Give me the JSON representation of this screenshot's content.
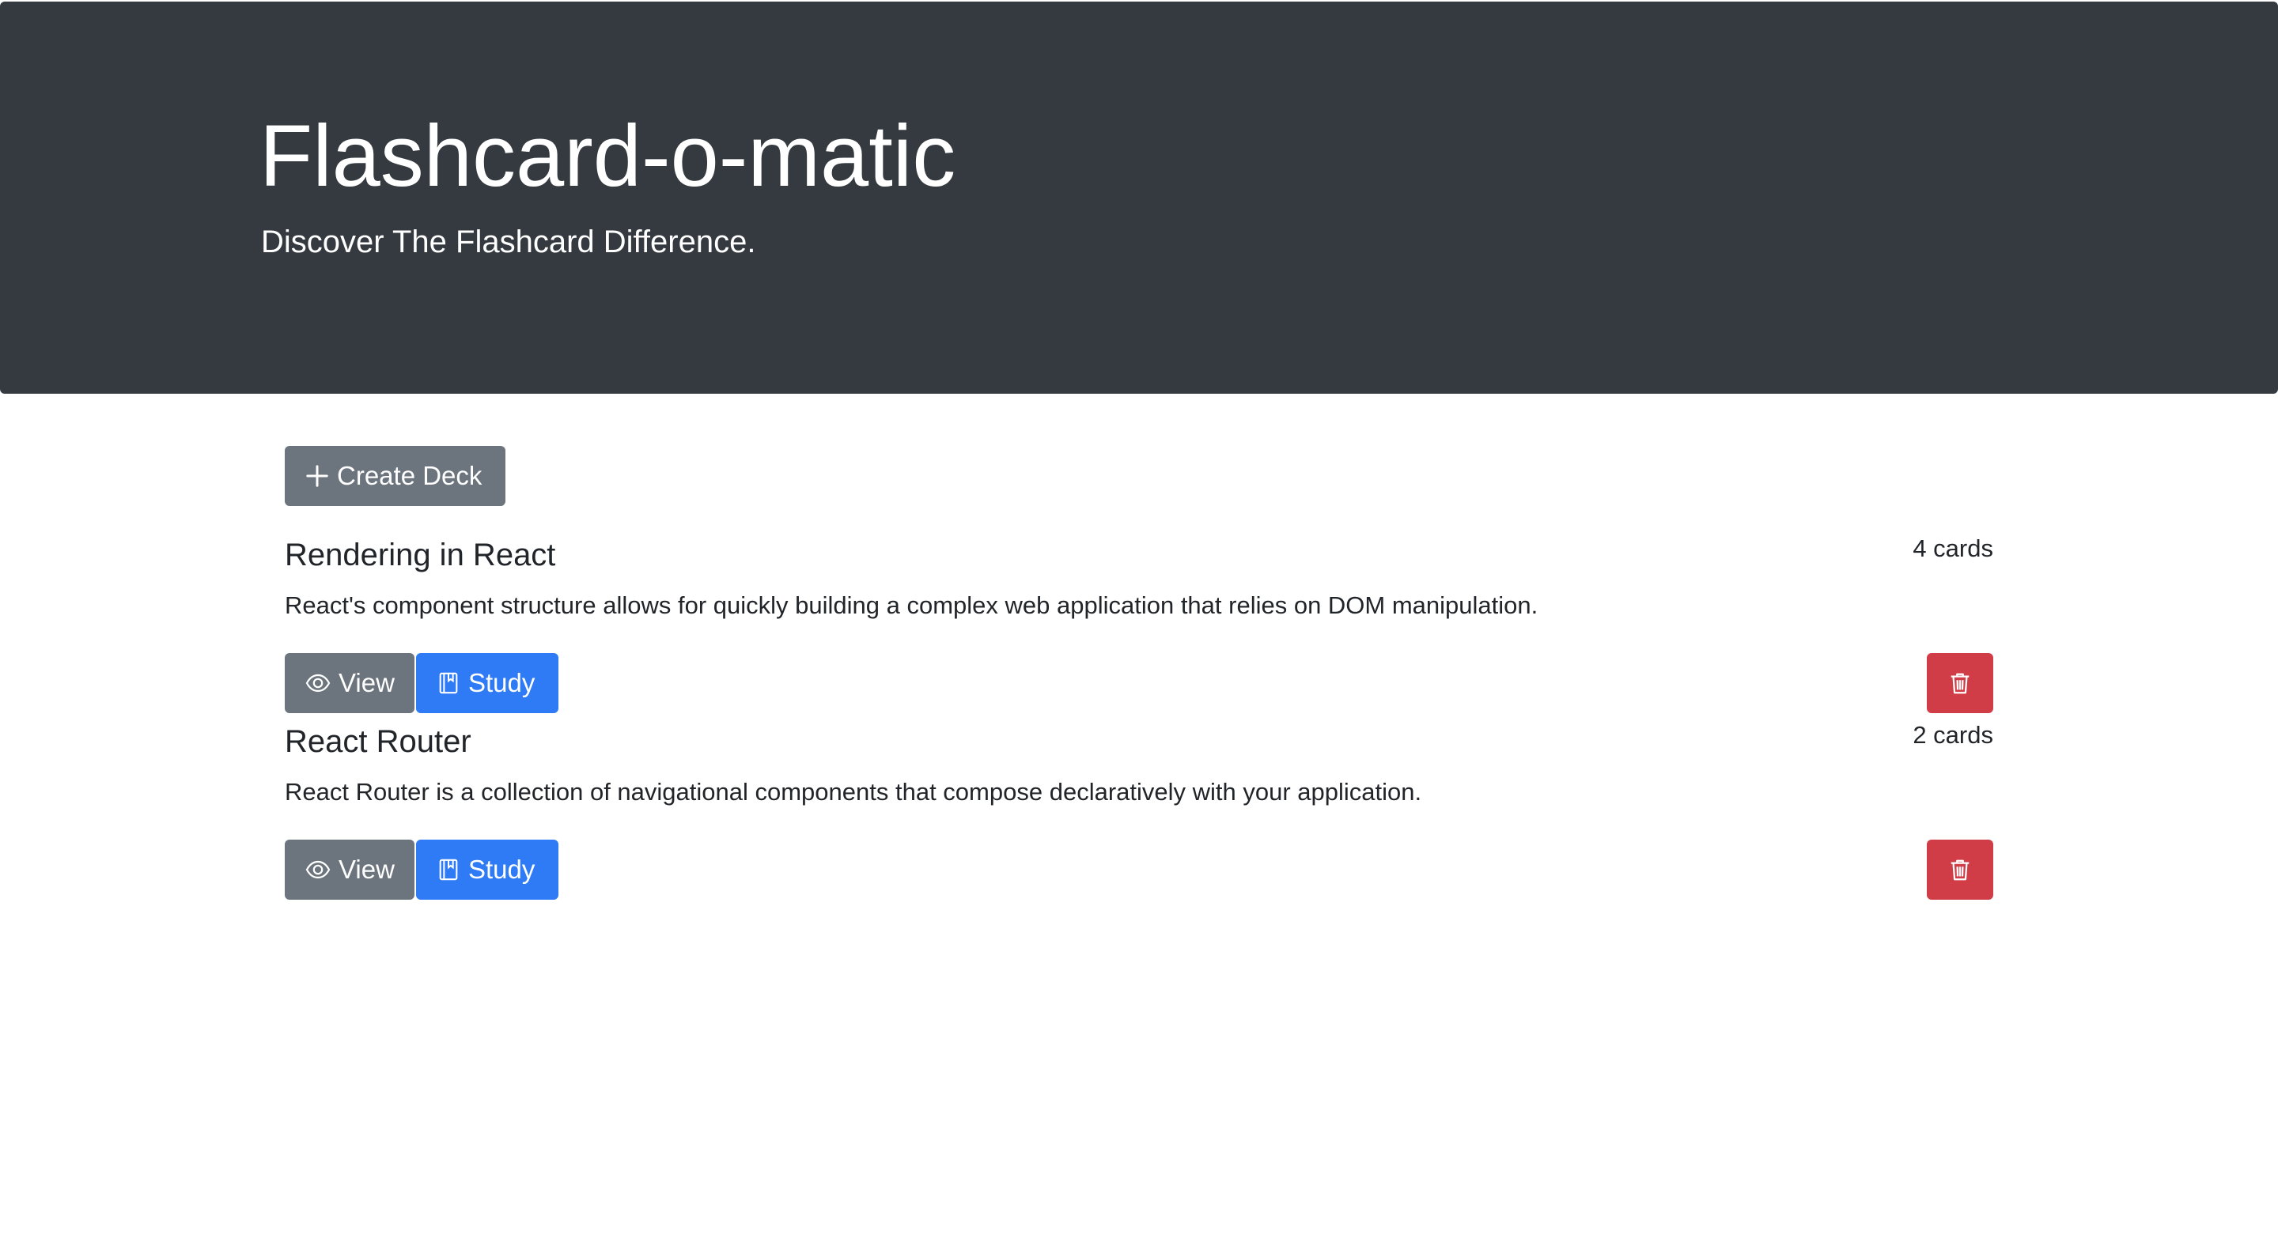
{
  "header": {
    "title": "Flashcard-o-matic",
    "subtitle": "Discover The Flashcard Difference."
  },
  "toolbar": {
    "create_label": "Create Deck",
    "create_icon": "plus-icon"
  },
  "decks": [
    {
      "name": "Rendering in React",
      "count": "4 cards",
      "description": "React's component structure allows for quickly building a complex web application that relies on DOM manipulation.",
      "view_label": "View",
      "study_label": "Study"
    },
    {
      "name": "React Router",
      "count": "2 cards",
      "description": "React Router is a collection of navigational components that compose declaratively with your application.",
      "view_label": "View",
      "study_label": "Study"
    }
  ],
  "colors": {
    "header_bg": "#343a40",
    "secondary": "#6c757d",
    "primary": "#2f7bf6",
    "danger": "#d13d47"
  }
}
